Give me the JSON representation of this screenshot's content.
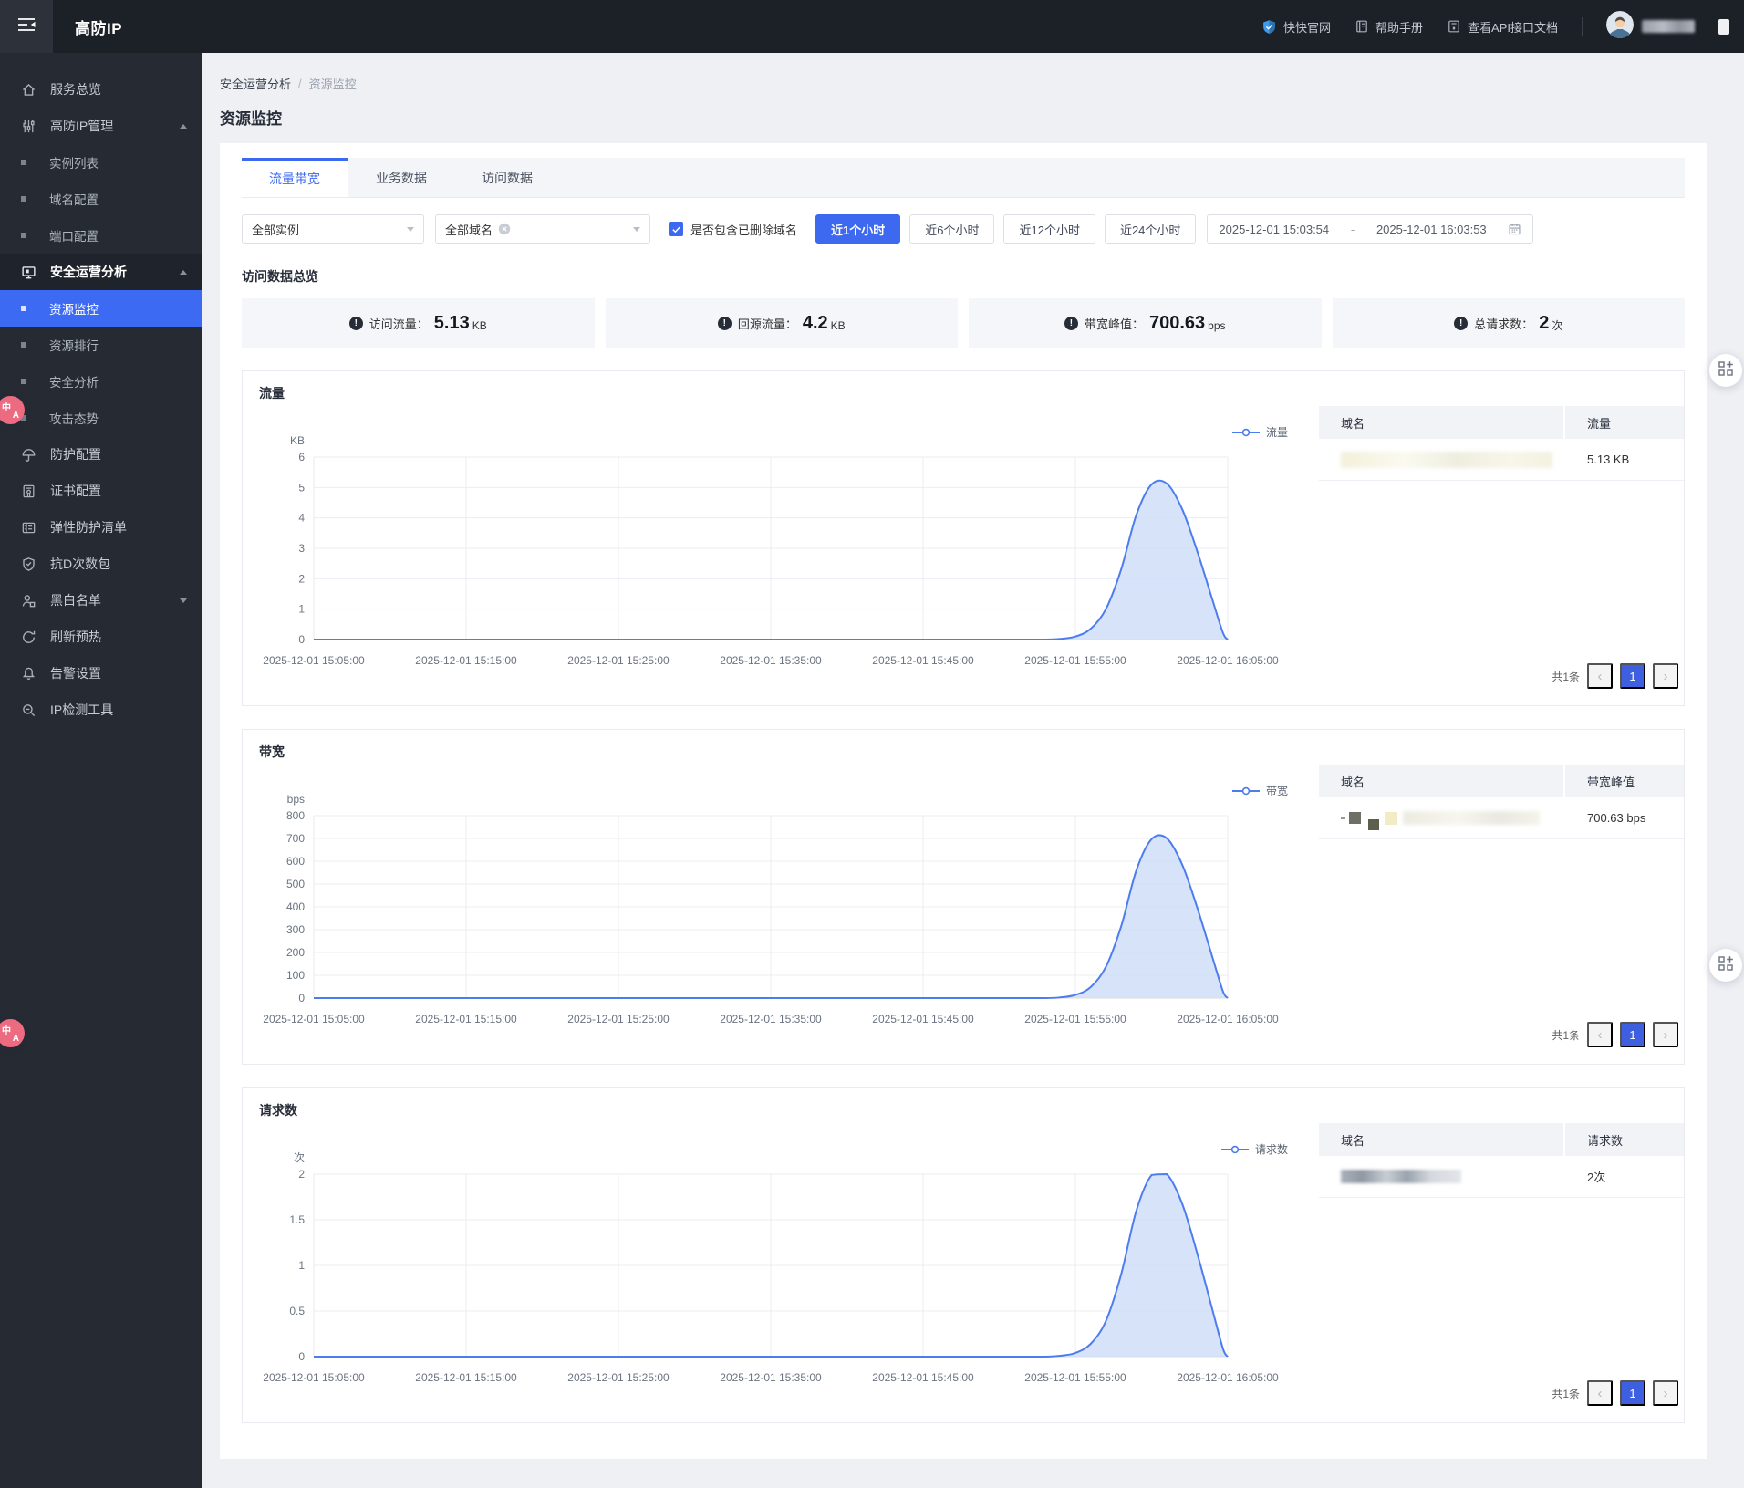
{
  "accent": "#3d68f0",
  "chart_line_color": "#4d7cef",
  "chart_fill_color": "#cfdef8",
  "topbar": {
    "title": "高防IP",
    "links": [
      {
        "key": "kuaikuai-site",
        "label": "快快官网",
        "icon": "shield-brand-icon"
      },
      {
        "key": "help-manual",
        "label": "帮助手册",
        "icon": "book-icon"
      },
      {
        "key": "api-docs",
        "label": "查看API接口文档",
        "icon": "api-doc-icon"
      }
    ],
    "user_masked": true
  },
  "sidebar": {
    "items": [
      {
        "key": "service-overview",
        "label": "服务总览",
        "icon": "home-icon"
      },
      {
        "key": "ip-management",
        "label": "高防IP管理",
        "icon": "sliders-icon",
        "expanded": true,
        "children": [
          {
            "key": "instance-list",
            "label": "实例列表"
          },
          {
            "key": "domain-config",
            "label": "域名配置"
          },
          {
            "key": "port-config",
            "label": "端口配置"
          }
        ]
      },
      {
        "key": "security-ops-analysis",
        "label": "安全运营分析",
        "icon": "monitor-icon",
        "expanded": true,
        "active_section": true,
        "children": [
          {
            "key": "resource-monitor",
            "label": "资源监控",
            "active": true
          },
          {
            "key": "resource-ranking",
            "label": "资源排行"
          },
          {
            "key": "security-analysis",
            "label": "安全分析"
          },
          {
            "key": "attack-posture",
            "label": "攻击态势"
          }
        ]
      },
      {
        "key": "protection-config",
        "label": "防护配置",
        "icon": "umbrella-icon"
      },
      {
        "key": "certificate-config",
        "label": "证书配置",
        "icon": "certificate-icon"
      },
      {
        "key": "elastic-protection-list",
        "label": "弹性防护清单",
        "icon": "list-icon"
      },
      {
        "key": "anti-ddos-package",
        "label": "抗D次数包",
        "icon": "shield-icon"
      },
      {
        "key": "black-white-list",
        "label": "黑白名单",
        "icon": "user-icon",
        "expanded": false
      },
      {
        "key": "refresh-preheat",
        "label": "刷新预热",
        "icon": "refresh-icon"
      },
      {
        "key": "alert-settings",
        "label": "告警设置",
        "icon": "bell-icon"
      },
      {
        "key": "ip-detection-tool",
        "label": "IP检测工具",
        "icon": "detect-icon"
      }
    ]
  },
  "breadcrumb": {
    "first": "安全运营分析",
    "separator": "/",
    "second": "资源监控"
  },
  "page": {
    "title": "资源监控"
  },
  "tabs": [
    {
      "key": "traffic-bandwidth",
      "label": "流量带宽",
      "active": true
    },
    {
      "key": "business-data",
      "label": "业务数据",
      "active": false
    },
    {
      "key": "access-data",
      "label": "访问数据",
      "active": false
    }
  ],
  "filters": {
    "instance_select": {
      "value": "全部实例"
    },
    "domain_select": {
      "value": "全部域名",
      "clearable": true
    },
    "include_deleted": {
      "label": "是否包含已删除域名",
      "checked": true
    },
    "time_ranges": [
      {
        "key": "last-1h",
        "label": "近1个小时",
        "active": true
      },
      {
        "key": "last-6h",
        "label": "近6个小时",
        "active": false
      },
      {
        "key": "last-12h",
        "label": "近12个小时",
        "active": false
      },
      {
        "key": "last-24h",
        "label": "近24个小时",
        "active": false
      }
    ],
    "date_range": {
      "start": "2025-12-01 15:03:54",
      "separator": "-",
      "end": "2025-12-01 16:03:53"
    }
  },
  "overview": {
    "title": "访问数据总览",
    "colon": "：",
    "stats": [
      {
        "key": "access-traffic",
        "label": "访问流量",
        "value": "5.13",
        "unit": "KB"
      },
      {
        "key": "origin-traffic",
        "label": "回源流量",
        "value": "4.2",
        "unit": "KB"
      },
      {
        "key": "bandwidth-peak",
        "label": "带宽峰值",
        "value": "700.63",
        "unit": "bps"
      },
      {
        "key": "total-requests",
        "label": "总请求数",
        "value": "2",
        "unit": "次"
      }
    ]
  },
  "charts": [
    {
      "key": "traffic",
      "title": "流量",
      "legend": "流量",
      "chart_data": {
        "type": "area",
        "unit": "KB",
        "ylim": [
          0,
          6
        ],
        "yticks": [
          6,
          5,
          4,
          3,
          2,
          1,
          0
        ],
        "x_labels": [
          "2025-12-01 15:05:00",
          "2025-12-01 15:15:00",
          "2025-12-01 15:25:00",
          "2025-12-01 15:35:00",
          "2025-12-01 15:45:00",
          "2025-12-01 15:55:00",
          "2025-12-01 16:05:00"
        ],
        "x_minutes": [
          0,
          5,
          10,
          15,
          20,
          25,
          30,
          35,
          40,
          45,
          48,
          49,
          50,
          51,
          52,
          53,
          54,
          55,
          56,
          57,
          58,
          59,
          59.7,
          60
        ],
        "values": [
          0,
          0,
          0,
          0,
          0,
          0,
          0,
          0,
          0,
          0,
          0,
          0.02,
          0.1,
          0.35,
          1.0,
          2.3,
          4.1,
          5.1,
          5.13,
          4.3,
          2.9,
          1.3,
          0.2,
          0
        ],
        "peak_value": 5.13,
        "grid": true,
        "legend_position": "top-right"
      },
      "table": {
        "columns": [
          "域名",
          "流量"
        ],
        "rows": [
          {
            "domain_masked": true,
            "mask_style": "mask-pale",
            "value": "5.13 KB"
          }
        ]
      },
      "pagination": {
        "total_label": "共1条",
        "page": "1"
      }
    },
    {
      "key": "bandwidth",
      "title": "带宽",
      "legend": "带宽",
      "chart_data": {
        "type": "area",
        "unit": "bps",
        "ylim": [
          0,
          800
        ],
        "yticks": [
          800,
          700,
          600,
          500,
          400,
          300,
          200,
          100,
          0
        ],
        "x_labels": [
          "2025-12-01 15:05:00",
          "2025-12-01 15:15:00",
          "2025-12-01 15:25:00",
          "2025-12-01 15:35:00",
          "2025-12-01 15:45:00",
          "2025-12-01 15:55:00",
          "2025-12-01 16:05:00"
        ],
        "x_minutes": [
          0,
          5,
          10,
          15,
          20,
          25,
          30,
          35,
          40,
          45,
          48,
          49,
          50,
          51,
          52,
          53,
          54,
          55,
          56,
          57,
          58,
          59,
          59.7,
          60
        ],
        "values": [
          0,
          0,
          0,
          0,
          0,
          0,
          0,
          0,
          0,
          0,
          0,
          3,
          14,
          48,
          137,
          314,
          560,
          697,
          700.63,
          587,
          396,
          178,
          27,
          0
        ],
        "peak_value": 700.63,
        "grid": true,
        "legend_position": "top-right"
      },
      "table": {
        "columns": [
          "域名",
          "带宽峰值"
        ],
        "rows": [
          {
            "domain_masked": true,
            "mask_style": "mask-dark",
            "value": "700.63 bps"
          }
        ]
      },
      "pagination": {
        "total_label": "共1条",
        "page": "1"
      }
    },
    {
      "key": "requests",
      "title": "请求数",
      "legend": "请求数",
      "chart_data": {
        "type": "area",
        "unit": "次",
        "ylim": [
          0,
          2
        ],
        "yticks": [
          2,
          1.5,
          1,
          0.5,
          0
        ],
        "x_labels": [
          "2025-12-01 15:05:00",
          "2025-12-01 15:15:00",
          "2025-12-01 15:25:00",
          "2025-12-01 15:35:00",
          "2025-12-01 15:45:00",
          "2025-12-01 15:55:00",
          "2025-12-01 16:05:00"
        ],
        "x_minutes": [
          0,
          5,
          10,
          15,
          20,
          25,
          30,
          35,
          40,
          45,
          48,
          49,
          50,
          51,
          52,
          53,
          54,
          55,
          56,
          57,
          58,
          59,
          59.7,
          60
        ],
        "values": [
          0,
          0,
          0,
          0,
          0,
          0,
          0,
          0,
          0,
          0,
          0,
          0.01,
          0.04,
          0.14,
          0.39,
          0.9,
          1.6,
          1.99,
          2,
          1.68,
          1.13,
          0.51,
          0.08,
          0
        ],
        "peak_value": 2,
        "grid": true,
        "legend_position": "top-right"
      },
      "table": {
        "columns": [
          "域名",
          "请求数"
        ],
        "rows": [
          {
            "domain_masked": true,
            "mask_style": "mask-gray",
            "value": "2次"
          }
        ]
      },
      "pagination": {
        "total_label": "共1条",
        "page": "1"
      }
    }
  ],
  "floating": {
    "translate_zh": "中",
    "translate_en": "A"
  }
}
